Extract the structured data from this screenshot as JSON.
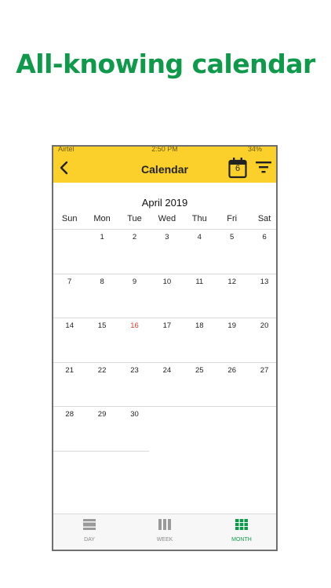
{
  "headline": "All-knowing calendar",
  "status": {
    "carrier": "Airtel",
    "time": "2:50 PM",
    "battery": "34%"
  },
  "header": {
    "title": "Calendar",
    "today_day": "6"
  },
  "month_title": "April 2019",
  "weekdays": [
    "Sun",
    "Mon",
    "Tue",
    "Wed",
    "Thu",
    "Fri",
    "Sat"
  ],
  "weeks": [
    [
      "",
      "1",
      "2",
      "3",
      "4",
      "5",
      "6"
    ],
    [
      "7",
      "8",
      "9",
      "10",
      "11",
      "12",
      "13"
    ],
    [
      "14",
      "15",
      "16",
      "17",
      "18",
      "19",
      "20"
    ],
    [
      "21",
      "22",
      "23",
      "24",
      "25",
      "26",
      "27"
    ],
    [
      "28",
      "29",
      "30",
      "",
      "",
      "",
      ""
    ]
  ],
  "highlight_day": "16",
  "colors": {
    "accent": "#fcd02b",
    "brand_green": "#0e9a4a",
    "today_red": "#e23a2e"
  },
  "tabs": [
    {
      "label": "DAY",
      "icon": "day-view-icon",
      "active": false
    },
    {
      "label": "WEEK",
      "icon": "week-view-icon",
      "active": false
    },
    {
      "label": "MONTH",
      "icon": "month-view-icon",
      "active": true
    }
  ]
}
